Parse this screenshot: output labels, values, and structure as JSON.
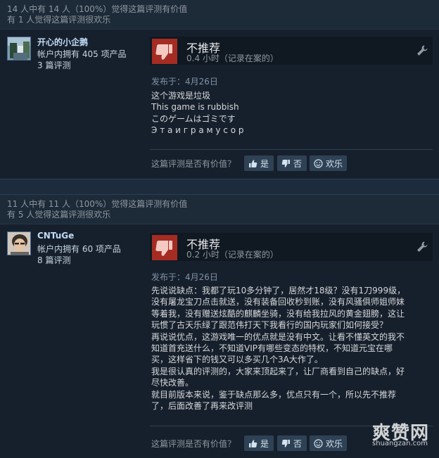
{
  "reviews": [
    {
      "helpful_summary": "14 人中有 14 人（100%）觉得这篇评测有价值",
      "funny_summary": "有 1 人觉得这篇评测很欢乐",
      "author": {
        "name": "开心的小企鹅",
        "products": "帐户内拥有 405 项产品",
        "reviews": "3 篇评测"
      },
      "verdict": "不推荐",
      "hours": "0.4 小时（记录在案的）",
      "posted": "发布于：4月26日",
      "body": [
        "这个游戏是垃圾",
        "This game is rubbish",
        "このゲームはゴミです",
        "Э т а  и г р а  м у с о р"
      ],
      "helpful_prompt": "这篇评测是否有价值？",
      "buttons": {
        "yes": "是",
        "no": "否",
        "funny": "欢乐"
      }
    },
    {
      "helpful_summary": "11 人中有 11 人（100%）觉得这篇评测有价值",
      "funny_summary": "有 5 人觉得这篇评测很欢乐",
      "author": {
        "name": "CNTuGe",
        "products": "帐户内拥有 60 项产品",
        "reviews": "8 篇评测"
      },
      "verdict": "不推荐",
      "hours": "0.2 小时（记录在案的）",
      "posted": "发布于：4月26日",
      "body": [
        "先说说缺点：我都了玩10多分钟了，居然才18级？没有1刀999级，",
        "没有屠龙宝刀点击就送，没有装备回收秒到账，没有风骚俱师姐师妹",
        "等着我，没有赠送炫酷的麒麟坐骑，没有给我拉风的黄金翅膀，这让",
        "玩惯了古天乐绿了跟范伟打天下我看行的国内玩家们如何接受？",
        "再说说优点，这游戏唯一的优点就是没有中文。让看不懂英文的我不",
        "知道首充送什么，不知道VIP有哪些变态的特权，不知道元宝在哪",
        "买，这样省下的钱又可以多买几个3A大作了。",
        "我是很认真的评测的，大家来顶起来了，让厂商看到自己的缺点，好",
        "尽快改善。",
        "就目前版本来说，鉴于缺点那么多，优点只有一个，所以先不推荐",
        "了，后面改善了再来改评测"
      ],
      "helpful_prompt": "这篇评测是否有价值？",
      "buttons": {
        "yes": "是",
        "no": "否",
        "funny": "欢乐"
      }
    }
  ],
  "watermark": {
    "big": "爽赞网",
    "small": "shuangzan.com"
  },
  "colors": {
    "page_bg": "#1b2838",
    "thumb_down_bg": "#a42c22",
    "author_name": "#c1dbf4",
    "button_bg": "#2f4154"
  }
}
